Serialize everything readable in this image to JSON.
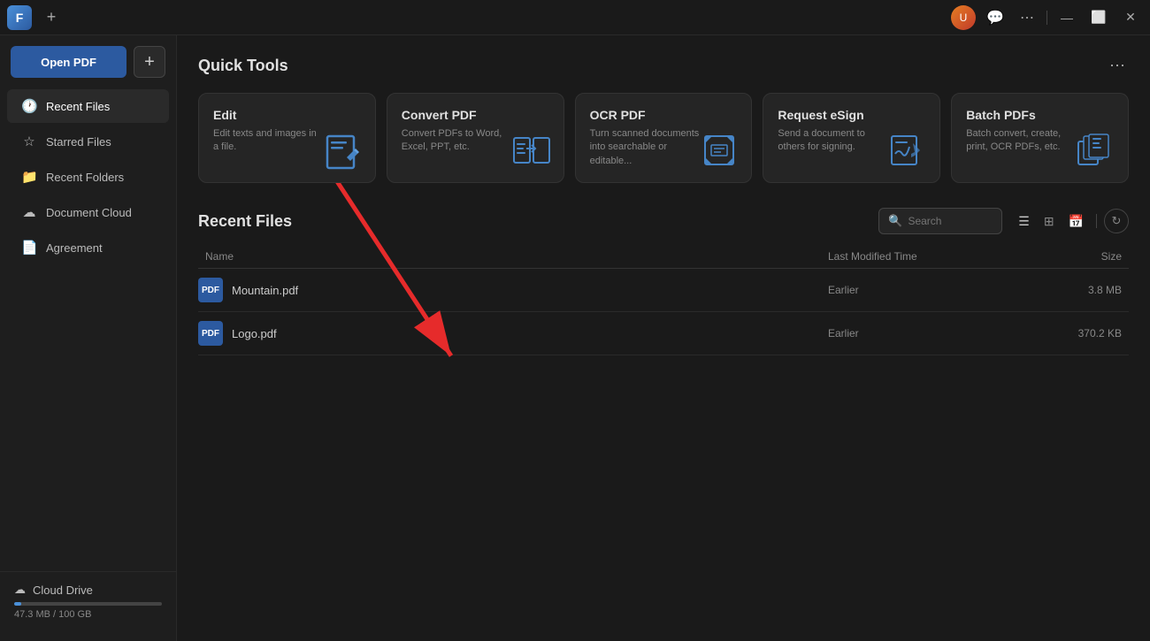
{
  "titleBar": {
    "appIconLabel": "F",
    "addTabLabel": "+",
    "avatarLabel": "U",
    "minimizeLabel": "—",
    "maximizeLabel": "⬜",
    "closeLabel": "✕",
    "moreOptionsLabel": "⋯",
    "chatIconLabel": "💬"
  },
  "sidebar": {
    "openPdfLabel": "Open PDF",
    "addLabel": "+",
    "navItems": [
      {
        "id": "recent-files",
        "icon": "🕐",
        "label": "Recent Files"
      },
      {
        "id": "starred-files",
        "icon": "☆",
        "label": "Starred Files"
      },
      {
        "id": "recent-folders",
        "icon": "📁",
        "label": "Recent Folders"
      },
      {
        "id": "document-cloud",
        "icon": "☁",
        "label": "Document Cloud"
      },
      {
        "id": "agreement",
        "icon": "📄",
        "label": "Agreement"
      }
    ],
    "cloudDrive": {
      "icon": "☁",
      "label": "Cloud Drive",
      "storageUsed": 47.3,
      "storageTotal": 100,
      "storageText": "47.3 MB / 100 GB",
      "fillPercent": 0.047
    }
  },
  "quickTools": {
    "title": "Quick Tools",
    "moreIcon": "⋯",
    "tools": [
      {
        "id": "edit",
        "title": "Edit",
        "description": "Edit texts and images in a file.",
        "iconSymbol": "✏"
      },
      {
        "id": "convert-pdf",
        "title": "Convert PDF",
        "description": "Convert PDFs to Word, Excel, PPT, etc.",
        "iconSymbol": "⇄"
      },
      {
        "id": "ocr-pdf",
        "title": "OCR PDF",
        "description": "Turn scanned documents into searchable or editable...",
        "iconSymbol": "⊡"
      },
      {
        "id": "request-esign",
        "title": "Request eSign",
        "description": "Send a document to others for signing.",
        "iconSymbol": "✍"
      },
      {
        "id": "batch-pdfs",
        "title": "Batch PDFs",
        "description": "Batch convert, create, print, OCR PDFs, etc.",
        "iconSymbol": "⧉"
      }
    ]
  },
  "recentFiles": {
    "title": "Recent Files",
    "searchPlaceholder": "Search",
    "columns": {
      "name": "Name",
      "lastModified": "Last Modified Time",
      "size": "Size"
    },
    "files": [
      {
        "id": "mountain-pdf",
        "name": "Mountain.pdf",
        "iconLabel": "PDF",
        "modified": "Earlier",
        "size": "3.8 MB"
      },
      {
        "id": "logo-pdf",
        "name": "Logo.pdf",
        "iconLabel": "PDF",
        "modified": "Earlier",
        "size": "370.2 KB"
      }
    ]
  }
}
